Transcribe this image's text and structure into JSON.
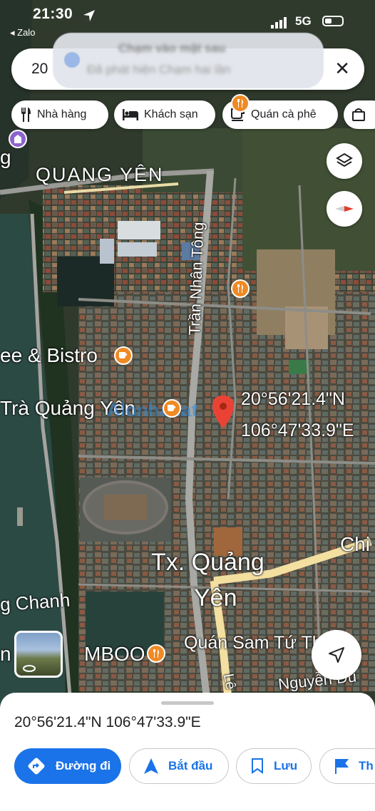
{
  "status_bar": {
    "time": "21:30",
    "back_app": "◂ Zalo",
    "network": "5G"
  },
  "notification": {
    "title": "Chạm vào mặt sau",
    "body": "Đã phát hiện Chạm hai lần"
  },
  "search": {
    "query": "20",
    "clear_icon": "close-icon"
  },
  "chips": [
    {
      "label": "Nhà hàng",
      "icon": "restaurant-icon"
    },
    {
      "label": "Khách sạn",
      "icon": "hotel-icon"
    },
    {
      "label": "Quán cà phê",
      "icon": "coffee-icon"
    }
  ],
  "map": {
    "area_label": "QUANG YÊN",
    "town_label_1": "Tx. Quảng",
    "town_label_2": "Yên",
    "street_tran_nhan_tong": "Trần Nhân Tông",
    "street_chanh": "g Chanh",
    "street_chi": "Chi",
    "street_le": "Lê",
    "street_nguyen": "Nguyễn Du",
    "poi_bistro": "ee & Bistro",
    "poi_tra": "Trà Quảng Yên",
    "poi_mboo": "MBOO",
    "poi_sam": "Quán Sam Tứ Thức",
    "n": "n",
    "g": "g",
    "pin_label_lat": "20°56'21.4\"N",
    "pin_label_lng": "106°47'33.9\"E",
    "watermark": "Alonhadat",
    "accent_color": "#1a73e8",
    "pin_color": "#ea4335"
  },
  "sheet": {
    "coordinates": "20°56'21.4\"N 106°47'33.9\"E",
    "actions": [
      {
        "label": "Đường đi",
        "icon": "directions-icon"
      },
      {
        "label": "Bắt đầu",
        "icon": "navigation-icon"
      },
      {
        "label": "Lưu",
        "icon": "bookmark-icon"
      },
      {
        "label": "Th",
        "icon": "flag-icon"
      }
    ]
  }
}
